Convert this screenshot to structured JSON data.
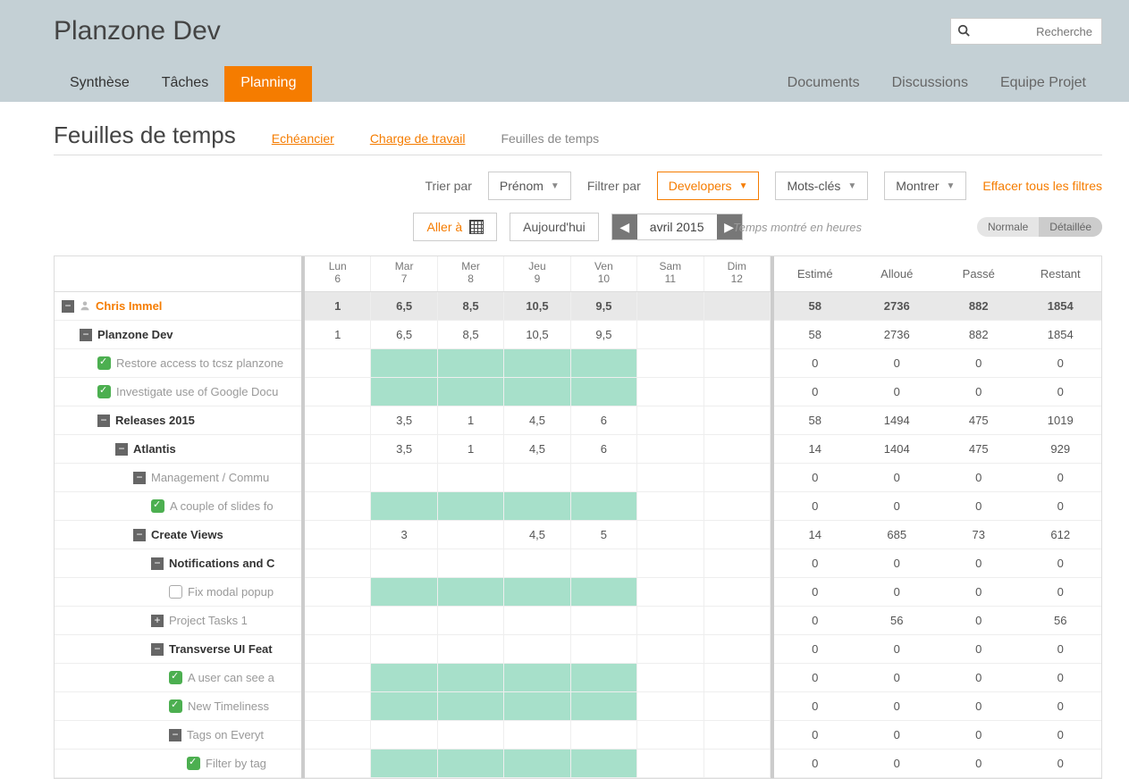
{
  "app_title": "Planzone Dev",
  "search_placeholder": "Recherche",
  "nav_left": [
    "Synthèse",
    "Tâches",
    "Planning"
  ],
  "nav_active": "Planning",
  "nav_right": [
    "Documents",
    "Discussions",
    "Equipe Projet"
  ],
  "page_title": "Feuilles de temps",
  "subnav": {
    "items": [
      "Echéancier",
      "Charge de travail",
      "Feuilles de temps"
    ],
    "inactive": "Feuilles de temps"
  },
  "filters": {
    "sort_label": "Trier par",
    "sort_value": "Prénom",
    "filter_label": "Filtrer par",
    "filter_value": "Developers",
    "keywords": "Mots-clés",
    "show": "Montrer",
    "clear": "Effacer tous les filtres"
  },
  "toolbar": {
    "goto": "Aller à",
    "today": "Aujourd'hui",
    "date": "avril 2015",
    "time_note": "Temps montré en heures",
    "view_normal": "Normale",
    "view_detailed": "Détaillée"
  },
  "days": [
    {
      "name": "Lun",
      "num": "6"
    },
    {
      "name": "Mar",
      "num": "7"
    },
    {
      "name": "Mer",
      "num": "8"
    },
    {
      "name": "Jeu",
      "num": "9"
    },
    {
      "name": "Ven",
      "num": "10"
    },
    {
      "name": "Sam",
      "num": "11"
    },
    {
      "name": "Dim",
      "num": "12"
    }
  ],
  "summary_headers": [
    "Estimé",
    "Alloué",
    "Passé",
    "Restant"
  ],
  "rows": [
    {
      "indent": 0,
      "toggle": "minus",
      "icon": "user",
      "label": "Chris Immel",
      "cls": "orange-txt",
      "days": [
        "1",
        "6,5",
        "8,5",
        "10,5",
        "9,5",
        "",
        ""
      ],
      "bold": true,
      "sum": [
        "58",
        "2736",
        "882",
        "1854"
      ]
    },
    {
      "indent": 1,
      "toggle": "minus",
      "label": "Planzone Dev",
      "cls": "bold-txt",
      "days": [
        "1",
        "6,5",
        "8,5",
        "10,5",
        "9,5",
        "",
        ""
      ],
      "sum": [
        "58",
        "2736",
        "882",
        "1854"
      ]
    },
    {
      "indent": 2,
      "chk": "chk",
      "label": "Restore access to tcsz planzone",
      "cls": "grey-txt",
      "days": [
        "",
        "g",
        "g",
        "g",
        "g",
        "",
        ""
      ],
      "sum": [
        "0",
        "0",
        "0",
        "0"
      ]
    },
    {
      "indent": 2,
      "chk": "chk",
      "label": "Investigate use of Google Docu",
      "cls": "grey-txt",
      "days": [
        "",
        "g",
        "g",
        "g",
        "g",
        "",
        ""
      ],
      "sum": [
        "0",
        "0",
        "0",
        "0"
      ]
    },
    {
      "indent": 2,
      "toggle": "minus",
      "label": "Releases 2015",
      "cls": "bold-txt",
      "days": [
        "",
        "3,5",
        "1",
        "4,5",
        "6",
        "",
        ""
      ],
      "sum": [
        "58",
        "1494",
        "475",
        "1019"
      ]
    },
    {
      "indent": 3,
      "toggle": "minus",
      "label": "Atlantis",
      "cls": "bold-txt",
      "days": [
        "",
        "3,5",
        "1",
        "4,5",
        "6",
        "",
        ""
      ],
      "sum": [
        "14",
        "1404",
        "475",
        "929"
      ]
    },
    {
      "indent": 4,
      "toggle": "minus",
      "label": "Management / Commu",
      "cls": "grey-txt",
      "days": [
        "",
        "",
        "",
        "",
        "",
        "",
        ""
      ],
      "sum": [
        "0",
        "0",
        "0",
        "0"
      ]
    },
    {
      "indent": 5,
      "chk": "chk",
      "label": "A couple of slides fo",
      "cls": "grey-txt",
      "days": [
        "",
        "g",
        "g",
        "g",
        "g",
        "",
        ""
      ],
      "sum": [
        "0",
        "0",
        "0",
        "0"
      ]
    },
    {
      "indent": 4,
      "toggle": "minus",
      "label": "Create Views",
      "cls": "bold-txt",
      "days": [
        "",
        "3",
        "",
        "4,5",
        "5",
        "",
        ""
      ],
      "sum": [
        "14",
        "685",
        "73",
        "612"
      ]
    },
    {
      "indent": 5,
      "toggle": "minus",
      "label": "Notifications and C",
      "cls": "bold-txt",
      "days": [
        "",
        "",
        "",
        "",
        "",
        "",
        ""
      ],
      "sum": [
        "0",
        "0",
        "0",
        "0"
      ]
    },
    {
      "indent": 6,
      "chk": "empty",
      "label": "Fix modal popup",
      "cls": "grey-txt",
      "days": [
        "",
        "g",
        "g",
        "g",
        "g",
        "",
        ""
      ],
      "sum": [
        "0",
        "0",
        "0",
        "0"
      ]
    },
    {
      "indent": 5,
      "toggle": "plus",
      "label": "Project Tasks 1",
      "cls": "grey-txt",
      "days": [
        "",
        "",
        "",
        "",
        "",
        "",
        ""
      ],
      "sum": [
        "0",
        "56",
        "0",
        "56"
      ]
    },
    {
      "indent": 5,
      "toggle": "minus",
      "label": "Transverse UI Feat",
      "cls": "bold-txt",
      "days": [
        "",
        "",
        "",
        "",
        "",
        "",
        ""
      ],
      "sum": [
        "0",
        "0",
        "0",
        "0"
      ]
    },
    {
      "indent": 6,
      "chk": "chk",
      "label": "A user can see a",
      "cls": "grey-txt",
      "days": [
        "",
        "g",
        "g",
        "g",
        "g",
        "",
        ""
      ],
      "sum": [
        "0",
        "0",
        "0",
        "0"
      ]
    },
    {
      "indent": 6,
      "chk": "chk",
      "label": "New Timeliness",
      "cls": "grey-txt",
      "days": [
        "",
        "g",
        "g",
        "g",
        "g",
        "",
        ""
      ],
      "sum": [
        "0",
        "0",
        "0",
        "0"
      ]
    },
    {
      "indent": 6,
      "toggle": "minus",
      "label": "Tags on Everyt",
      "cls": "grey-txt",
      "days": [
        "",
        "",
        "",
        "",
        "",
        "",
        ""
      ],
      "sum": [
        "0",
        "0",
        "0",
        "0"
      ]
    },
    {
      "indent": 7,
      "chk": "chk",
      "label": "Filter by tag",
      "cls": "grey-txt",
      "days": [
        "",
        "g",
        "g",
        "g",
        "g",
        "",
        ""
      ],
      "sum": [
        "0",
        "0",
        "0",
        "0"
      ]
    }
  ]
}
